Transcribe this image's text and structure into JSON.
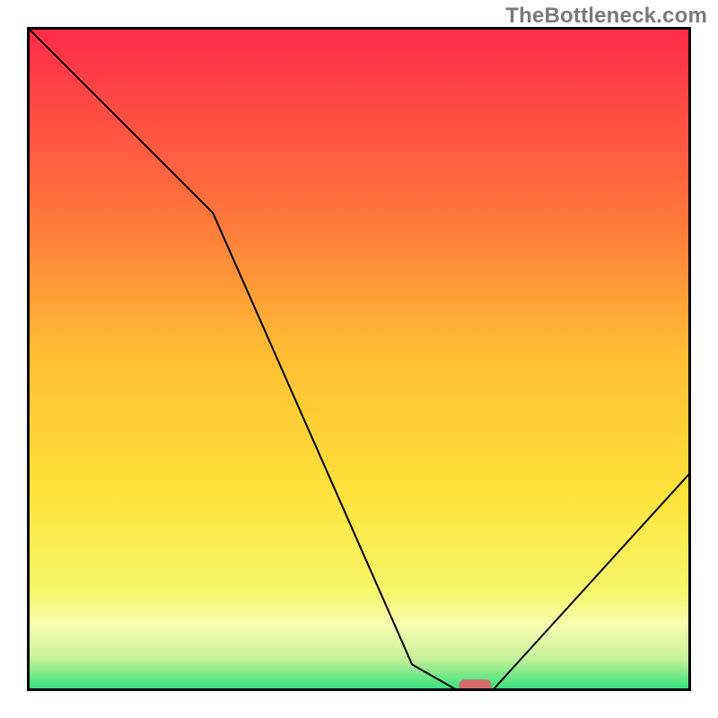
{
  "watermark": "TheBottleneck.com",
  "chart_data": {
    "type": "line",
    "title": "",
    "xlabel": "",
    "ylabel": "",
    "xlim": [
      0,
      100
    ],
    "ylim": [
      0,
      100
    ],
    "x": [
      0,
      28,
      58,
      65,
      70,
      100
    ],
    "values": [
      100,
      72,
      4,
      0,
      0,
      33
    ],
    "marker": {
      "x": 67.5,
      "y": 0.8,
      "color": "#d46a6a"
    },
    "gradient_stops": [
      {
        "offset": 0.0,
        "color": "#ff2b4b"
      },
      {
        "offset": 0.25,
        "color": "#ff6b3d"
      },
      {
        "offset": 0.5,
        "color": "#ffbf33"
      },
      {
        "offset": 0.7,
        "color": "#ffe23a"
      },
      {
        "offset": 0.85,
        "color": "#f6f76a"
      },
      {
        "offset": 0.9,
        "color": "#f8fcb0"
      },
      {
        "offset": 0.95,
        "color": "#c9f29a"
      },
      {
        "offset": 1.0,
        "color": "#2be07a"
      }
    ],
    "frame_color": "#000000",
    "line_color": "#000000",
    "line_width": 2
  }
}
